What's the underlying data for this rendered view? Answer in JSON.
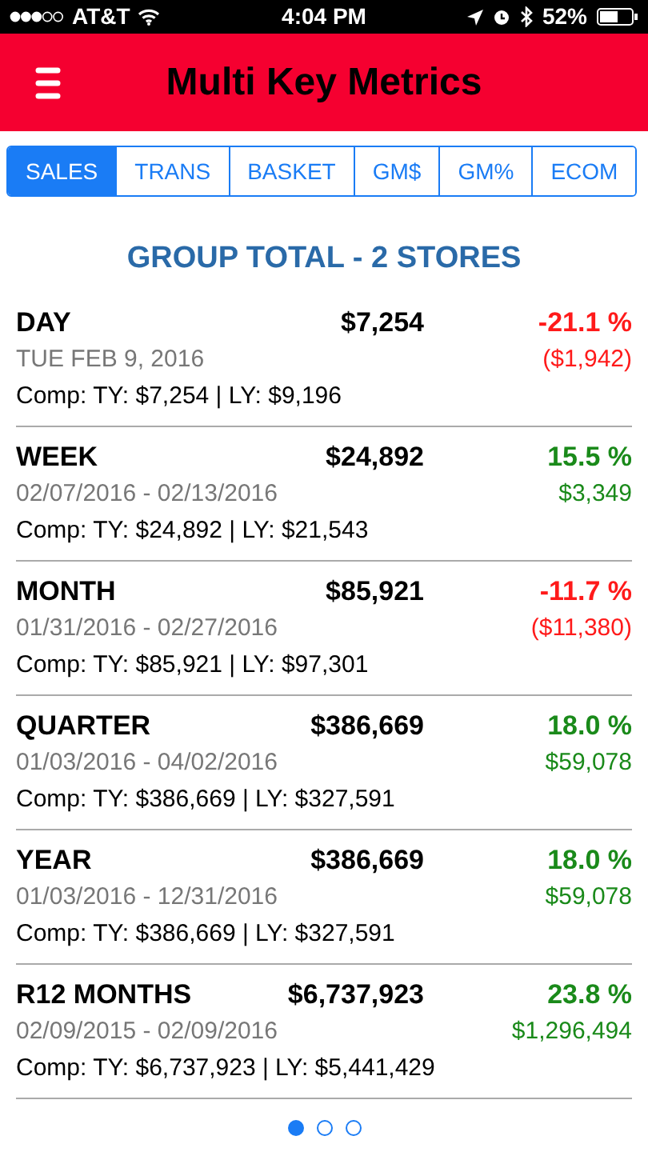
{
  "status_bar": {
    "carrier": "AT&T",
    "time": "4:04 PM",
    "battery": "52%"
  },
  "header": {
    "title": "Multi Key Metrics"
  },
  "tabs": [
    {
      "label": "SALES",
      "selected": true
    },
    {
      "label": "TRANS",
      "selected": false
    },
    {
      "label": "BASKET",
      "selected": false
    },
    {
      "label": "GM$",
      "selected": false
    },
    {
      "label": "GM%",
      "selected": false
    },
    {
      "label": "ECOM",
      "selected": false
    }
  ],
  "group_title": "GROUP TOTAL - 2 STORES",
  "metrics": [
    {
      "period": "DAY",
      "value": "$7,254",
      "change": "-21.1 %",
      "range": "TUE FEB 9, 2016",
      "delta": "($1,942)",
      "comp": "Comp: TY: $7,254 | LY: $9,196",
      "color": "#ff1a1a"
    },
    {
      "period": "WEEK",
      "value": "$24,892",
      "change": "15.5 %",
      "range": "02/07/2016 - 02/13/2016",
      "delta": "$3,349",
      "comp": "Comp: TY: $24,892 | LY: $21,543",
      "color": "#1a8a1a"
    },
    {
      "period": "MONTH",
      "value": "$85,921",
      "change": "-11.7 %",
      "range": "01/31/2016 - 02/27/2016",
      "delta": "($11,380)",
      "comp": "Comp: TY: $85,921 | LY: $97,301",
      "color": "#ff1a1a"
    },
    {
      "period": "QUARTER",
      "value": "$386,669",
      "change": "18.0 %",
      "range": "01/03/2016 - 04/02/2016",
      "delta": "$59,078",
      "comp": "Comp: TY: $386,669 | LY: $327,591",
      "color": "#1a8a1a"
    },
    {
      "period": "YEAR",
      "value": "$386,669",
      "change": "18.0 %",
      "range": "01/03/2016 - 12/31/2016",
      "delta": "$59,078",
      "comp": "Comp: TY: $386,669 | LY: $327,591",
      "color": "#1a8a1a"
    },
    {
      "period": "R12 MONTHS",
      "value": "$6,737,923",
      "change": "23.8 %",
      "range": "02/09/2015 - 02/09/2016",
      "delta": "$1,296,494",
      "comp": "Comp: TY: $6,737,923 | LY: $5,441,429",
      "color": "#1a8a1a"
    }
  ],
  "pages": [
    {
      "selected": true
    },
    {
      "selected": false
    },
    {
      "selected": false
    }
  ]
}
